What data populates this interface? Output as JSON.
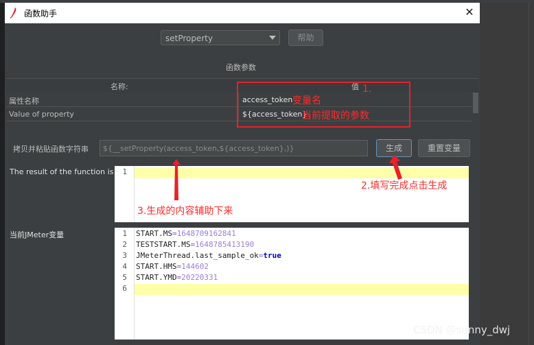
{
  "window": {
    "title": "函数助手",
    "close_glyph": "✕",
    "app_icon": "feather-icon"
  },
  "function_select": {
    "selected": "setProperty"
  },
  "help_button": {
    "label": "帮助"
  },
  "params_section": {
    "title": "函数参数",
    "columns": {
      "name": "名称:",
      "value": "值"
    },
    "rows": [
      {
        "name": "属性名称",
        "value": "access_token"
      },
      {
        "name": "Value of property",
        "value": "${access_token}"
      }
    ]
  },
  "copy_row": {
    "label": "拷贝并粘贴函数字符串",
    "value": "${__setProperty(access_token,${access_token},)}",
    "generate_label": "生成",
    "reset_label": "重置变量"
  },
  "result": {
    "label": "The result of the function is",
    "line_numbers": [
      "1"
    ]
  },
  "jmeter_vars": {
    "label": "当前JMeter变量",
    "line_numbers": [
      "1",
      "2",
      "3",
      "4",
      "5",
      "6"
    ],
    "lines": [
      {
        "key": "START.MS",
        "value": "1648709162841"
      },
      {
        "key": "TESTSTART.MS",
        "value": "1648785413190"
      },
      {
        "key": "JMeterThread.last_sample_ok",
        "value": "true"
      },
      {
        "key": "START.HMS",
        "value": "144602"
      },
      {
        "key": "START.YMD",
        "value": "20220331"
      }
    ]
  },
  "annotations": {
    "box_label": "1.",
    "var_name": "变量名",
    "current_param": "当前提取的参数",
    "step2": "2.填写完成点击生成",
    "step3": "3.生成的内容辅助下来"
  },
  "colors": {
    "annotation_red": "#e8212b",
    "dialog_bg": "#3c3f41",
    "editor_highlight": "#ffffaa"
  },
  "watermark": "CSDN @sunny_dwj"
}
